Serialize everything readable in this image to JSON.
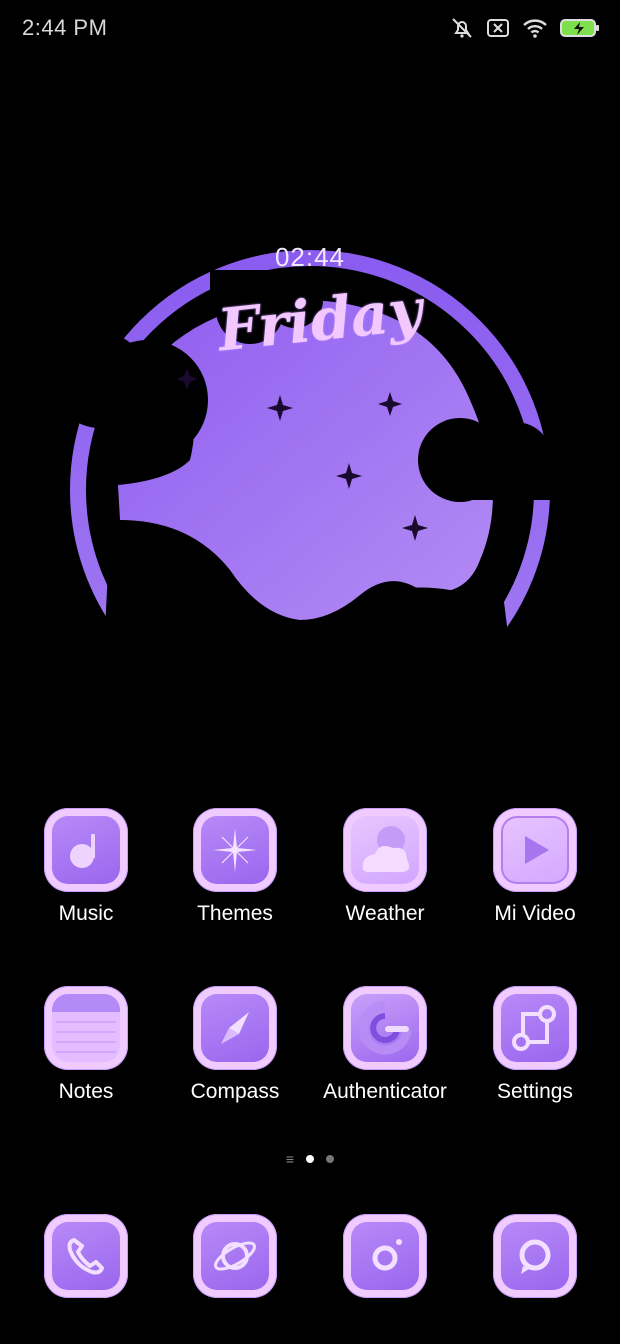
{
  "status_bar": {
    "time": "2:44 PM",
    "icons": [
      "silent-bell-icon",
      "sim-disabled-icon",
      "wifi-icon",
      "battery-charging-icon"
    ],
    "battery_color": "#7ee04c"
  },
  "widget": {
    "time": "02:44",
    "day": "Friday",
    "accent": "#9b6cf0"
  },
  "apps": [
    {
      "label": "Music",
      "icon": "music-note-icon"
    },
    {
      "label": "Themes",
      "icon": "sparkle-icon"
    },
    {
      "label": "Weather",
      "icon": "cloud-moon-icon"
    },
    {
      "label": "Mi Video",
      "icon": "play-icon"
    },
    {
      "label": "Notes",
      "icon": "notepad-icon"
    },
    {
      "label": "Compass",
      "icon": "compass-needle-icon"
    },
    {
      "label": "Authenticator",
      "icon": "g-authenticator-icon"
    },
    {
      "label": "Settings",
      "icon": "settings-nodes-icon"
    }
  ],
  "page_indicator": {
    "menu": "≡",
    "pages": 2,
    "active": 0
  },
  "dock": [
    {
      "icon": "phone-icon"
    },
    {
      "icon": "planet-browser-icon"
    },
    {
      "icon": "camera-icon"
    },
    {
      "icon": "message-bubble-icon"
    }
  ],
  "colors": {
    "tile_bg": "#f0cbff",
    "tile_inner": "#a473f2",
    "background": "#000000"
  }
}
